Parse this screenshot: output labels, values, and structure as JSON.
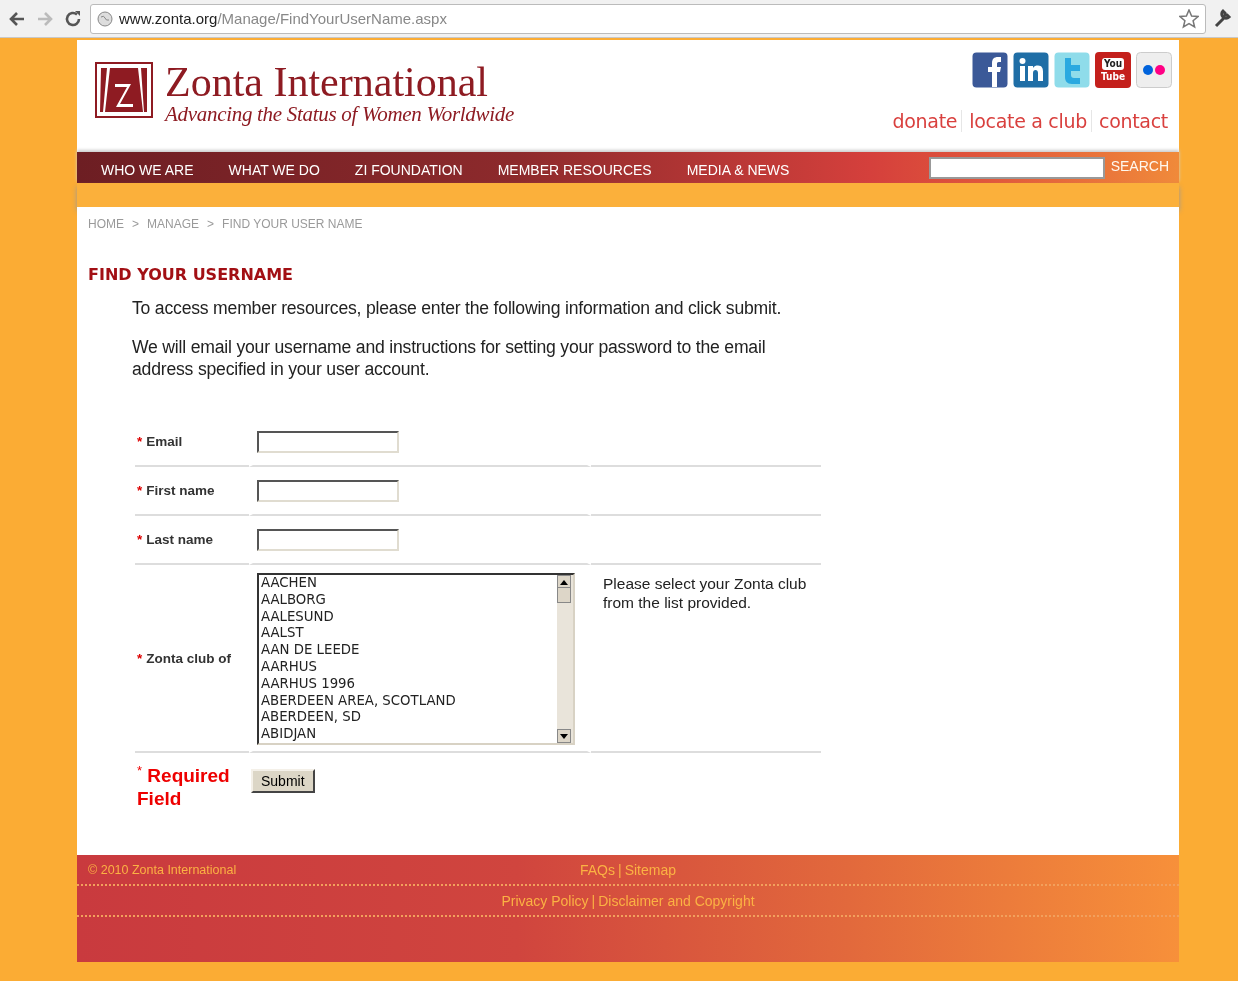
{
  "browser": {
    "url_host": "www.zonta.org",
    "url_path": "/Manage/FindYourUserName.aspx"
  },
  "header": {
    "title": "Zonta International",
    "tagline": "Advancing the Status of Women Worldwide",
    "social": [
      {
        "kind": "facebook"
      },
      {
        "kind": "linkedin"
      },
      {
        "kind": "twitter"
      },
      {
        "kind": "youtube",
        "label_top": "You",
        "label_bottom": "Tube"
      },
      {
        "kind": "flickr"
      }
    ],
    "utility_links": [
      "donate",
      "locate a club",
      "contact"
    ]
  },
  "nav": {
    "items": [
      "WHO WE ARE",
      "WHAT WE DO",
      "ZI FOUNDATION",
      "MEMBER RESOURCES",
      "MEDIA & NEWS"
    ],
    "search_button": "SEARCH"
  },
  "breadcrumb": {
    "items": [
      "HOME",
      "MANAGE",
      "FIND YOUR USER NAME"
    ],
    "separator": ">"
  },
  "page_title": "FIND YOUR USERNAME",
  "intro": [
    "To access member resources, please enter the following information and click submit.",
    "We will email your username and instructions for setting your password to the email address specified in your user account."
  ],
  "form": {
    "fields": [
      {
        "kind": "text",
        "label": "Email",
        "required": true
      },
      {
        "kind": "text",
        "label": "First name",
        "required": true
      },
      {
        "kind": "text",
        "label": "Last name",
        "required": true
      },
      {
        "kind": "listbox",
        "label": "Zonta club of",
        "required": true,
        "hint": "Please select your Zonta club from the list provided.",
        "options": [
          "AACHEN",
          "AALBORG",
          "AALESUND",
          "AALST",
          "AAN DE LEEDE",
          "AARHUS",
          "AARHUS 1996",
          "ABERDEEN AREA, SCOTLAND",
          "ABERDEEN, SD",
          "ABIDJAN"
        ]
      }
    ],
    "required_note": {
      "mark": "*",
      "text": "Required Field"
    },
    "submit": "Submit"
  },
  "footer": {
    "copyright": "© 2010 Zonta International",
    "rows": [
      [
        "FAQs",
        "Sitemap"
      ],
      [
        "Privacy Policy",
        "Disclaimer and Copyright"
      ]
    ],
    "separator": "|"
  }
}
